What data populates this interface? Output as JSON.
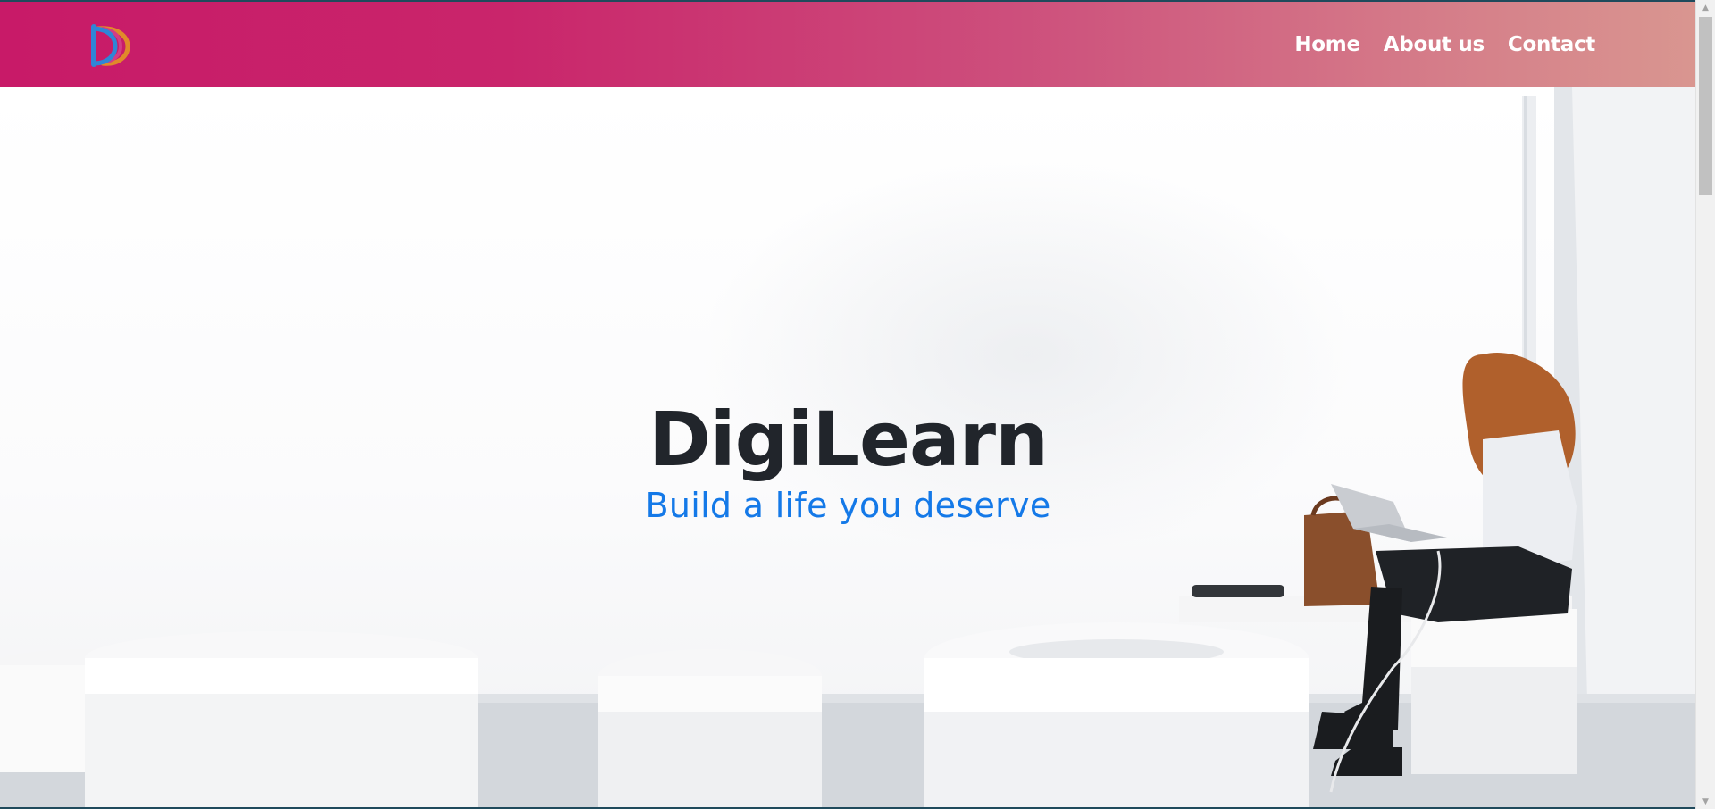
{
  "nav": {
    "logo_icon": "digilearn-logo-icon",
    "links": [
      {
        "label": "Home"
      },
      {
        "label": "About us"
      },
      {
        "label": "Contact"
      }
    ]
  },
  "hero": {
    "title": "DigiLearn",
    "subtitle": "Build a life you deserve"
  },
  "colors": {
    "navbar_start": "#c81a68",
    "navbar_end": "#d99690",
    "title": "#21252b",
    "subtitle": "#1479e8"
  }
}
